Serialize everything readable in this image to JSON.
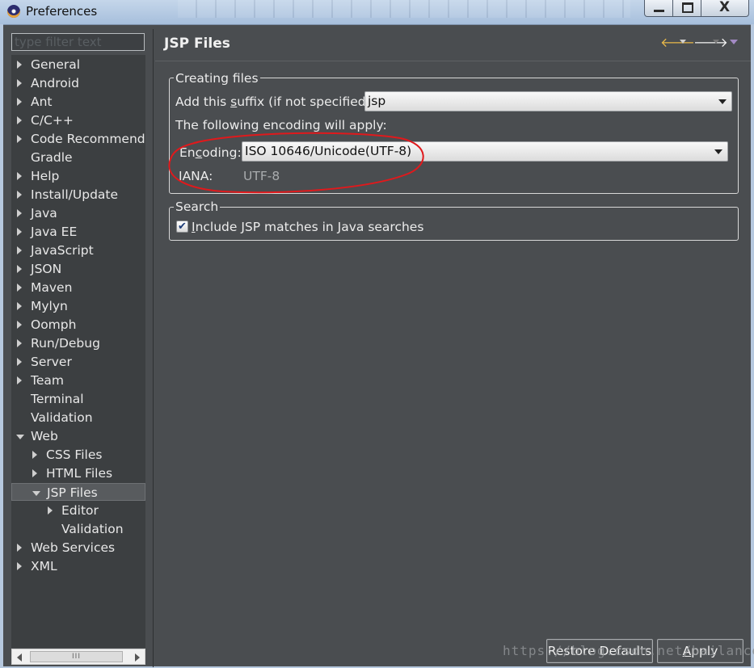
{
  "window": {
    "title": "Preferences",
    "close_glyph": "X",
    "minimize_icon": "minimize-icon",
    "maximize_icon": "maximize-icon"
  },
  "sidebar": {
    "filter_placeholder": "type filter text",
    "items": [
      {
        "label": "General",
        "level": 0,
        "expandable": true,
        "expanded": false
      },
      {
        "label": "Android",
        "level": 0,
        "expandable": true,
        "expanded": false
      },
      {
        "label": "Ant",
        "level": 0,
        "expandable": true,
        "expanded": false
      },
      {
        "label": "C/C++",
        "level": 0,
        "expandable": true,
        "expanded": false
      },
      {
        "label": "Code Recommenders",
        "level": 0,
        "expandable": true,
        "expanded": false
      },
      {
        "label": "Gradle",
        "level": 0,
        "expandable": false,
        "expanded": false
      },
      {
        "label": "Help",
        "level": 0,
        "expandable": true,
        "expanded": false
      },
      {
        "label": "Install/Update",
        "level": 0,
        "expandable": true,
        "expanded": false
      },
      {
        "label": "Java",
        "level": 0,
        "expandable": true,
        "expanded": false
      },
      {
        "label": "Java EE",
        "level": 0,
        "expandable": true,
        "expanded": false
      },
      {
        "label": "JavaScript",
        "level": 0,
        "expandable": true,
        "expanded": false
      },
      {
        "label": "JSON",
        "level": 0,
        "expandable": true,
        "expanded": false
      },
      {
        "label": "Maven",
        "level": 0,
        "expandable": true,
        "expanded": false
      },
      {
        "label": "Mylyn",
        "level": 0,
        "expandable": true,
        "expanded": false
      },
      {
        "label": "Oomph",
        "level": 0,
        "expandable": true,
        "expanded": false
      },
      {
        "label": "Run/Debug",
        "level": 0,
        "expandable": true,
        "expanded": false
      },
      {
        "label": "Server",
        "level": 0,
        "expandable": true,
        "expanded": false
      },
      {
        "label": "Team",
        "level": 0,
        "expandable": true,
        "expanded": false
      },
      {
        "label": "Terminal",
        "level": 0,
        "expandable": false,
        "expanded": false
      },
      {
        "label": "Validation",
        "level": 0,
        "expandable": false,
        "expanded": false
      },
      {
        "label": "Web",
        "level": 0,
        "expandable": true,
        "expanded": true
      },
      {
        "label": "CSS Files",
        "level": 1,
        "expandable": true,
        "expanded": false
      },
      {
        "label": "HTML Files",
        "level": 1,
        "expandable": true,
        "expanded": false
      },
      {
        "label": "JSP Files",
        "level": 1,
        "expandable": true,
        "expanded": true,
        "selected": true
      },
      {
        "label": "Editor",
        "level": 2,
        "expandable": true,
        "expanded": false
      },
      {
        "label": "Validation",
        "level": 2,
        "expandable": false,
        "expanded": false
      },
      {
        "label": "Web Services",
        "level": 0,
        "expandable": true,
        "expanded": false
      },
      {
        "label": "XML",
        "level": 0,
        "expandable": true,
        "expanded": false
      }
    ],
    "scrollbar_thumb": "III"
  },
  "page": {
    "title": "JSP Files",
    "nav_back_icon": "back-arrow-icon",
    "nav_forward_icon": "forward-arrow-icon"
  },
  "creating_files": {
    "legend": "Creating files",
    "suffix_label_pre": "Add this ",
    "suffix_label_u": "s",
    "suffix_label_post": "uffix (if not specified):",
    "suffix_value": "jsp",
    "encoding_note": "The following encoding will apply:",
    "encoding_label_pre": "En",
    "encoding_label_u": "c",
    "encoding_label_post": "oding:",
    "encoding_value": "ISO 10646/Unicode(UTF-8)",
    "iana_label": "IANA:",
    "iana_value": "UTF-8",
    "highlight_color": "#e0191c"
  },
  "search": {
    "legend": "Search",
    "checkbox_checked": true,
    "checkbox_glyph": "✔",
    "checkbox_label_pre": "",
    "checkbox_label_u": "I",
    "checkbox_label_post": "nclude JSP matches in Java searches"
  },
  "buttons": {
    "restore": "Restore Defaults",
    "apply_u": "A",
    "apply_rest": "pply"
  },
  "watermark": "https://blog.csdn.net/bailance"
}
